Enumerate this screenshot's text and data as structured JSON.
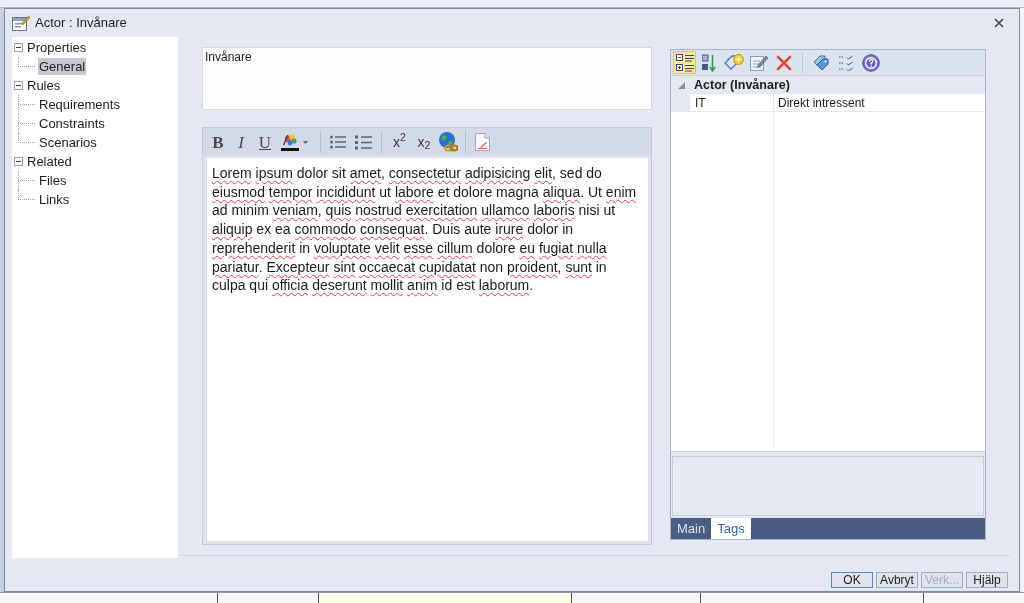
{
  "window": {
    "title": "Actor : Invånare"
  },
  "tree": [
    {
      "label": "Properties",
      "expanded": true,
      "selected": false,
      "children": [
        {
          "label": "General",
          "selected": true
        }
      ]
    },
    {
      "label": "Rules",
      "expanded": true,
      "selected": false,
      "children": [
        {
          "label": "Requirements",
          "selected": false
        },
        {
          "label": "Constraints",
          "selected": false
        },
        {
          "label": "Scenarios",
          "selected": false
        }
      ]
    },
    {
      "label": "Related",
      "expanded": true,
      "selected": false,
      "children": [
        {
          "label": "Files",
          "selected": false
        },
        {
          "label": "Links",
          "selected": false
        }
      ]
    }
  ],
  "name_field": {
    "value": "Invånare"
  },
  "editor": {
    "toolbar": [
      {
        "kind": "bold",
        "label": "B"
      },
      {
        "kind": "italic",
        "label": "I"
      },
      {
        "kind": "underline",
        "label": "U"
      },
      {
        "kind": "font-color"
      },
      {
        "kind": "separator"
      },
      {
        "kind": "bullets"
      },
      {
        "kind": "numbering"
      },
      {
        "kind": "separator"
      },
      {
        "kind": "superscript",
        "label": "x$^{2}$"
      },
      {
        "kind": "subscript",
        "label": "x$_{2}$"
      },
      {
        "kind": "hyperlink"
      },
      {
        "kind": "separator"
      },
      {
        "kind": "document"
      }
    ],
    "runs": [
      {
        "text": "Lorem ipsum",
        "misspelled": true
      },
      {
        "text": " dolor sit ",
        "misspelled": false
      },
      {
        "text": "amet",
        "misspelled": true
      },
      {
        "text": ", ",
        "misspelled": false
      },
      {
        "text": "consectetur adipisicing elit",
        "misspelled": true
      },
      {
        "text": ", sed do ",
        "misspelled": false
      },
      {
        "text": "eiusmod tempor incididunt",
        "misspelled": true
      },
      {
        "text": " ut ",
        "misspelled": false
      },
      {
        "text": "labore",
        "misspelled": true
      },
      {
        "text": " et dolore magna ",
        "misspelled": false
      },
      {
        "text": "aliqua",
        "misspelled": true
      },
      {
        "text": ". Ut ",
        "misspelled": false
      },
      {
        "text": "enim",
        "misspelled": true
      },
      {
        "text": " ad minim ",
        "misspelled": false
      },
      {
        "text": "veniam",
        "misspelled": true
      },
      {
        "text": ", ",
        "misspelled": false
      },
      {
        "text": "quis nostrud exercitation ullamco laboris",
        "misspelled": true
      },
      {
        "text": " nisi ut ",
        "misspelled": false
      },
      {
        "text": "aliquip",
        "misspelled": true
      },
      {
        "text": " ex ea ",
        "misspelled": false
      },
      {
        "text": "commodo consequat",
        "misspelled": true
      },
      {
        "text": ". Duis aute ",
        "misspelled": false
      },
      {
        "text": "irure",
        "misspelled": true
      },
      {
        "text": " dolor in ",
        "misspelled": false
      },
      {
        "text": "reprehenderit",
        "misspelled": true
      },
      {
        "text": " in ",
        "misspelled": false
      },
      {
        "text": "voluptate velit esse cillum",
        "misspelled": true
      },
      {
        "text": " dolore ",
        "misspelled": false
      },
      {
        "text": "eu fugiat nulla pariatur",
        "misspelled": true
      },
      {
        "text": ". ",
        "misspelled": false
      },
      {
        "text": "Excepteur sint occaecat cupidatat",
        "misspelled": true
      },
      {
        "text": " non ",
        "misspelled": false
      },
      {
        "text": "proident",
        "misspelled": true
      },
      {
        "text": ", ",
        "misspelled": false
      },
      {
        "text": "sunt",
        "misspelled": true
      },
      {
        "text": " in culpa qui ",
        "misspelled": false
      },
      {
        "text": "officia deserunt mollit anim",
        "misspelled": true
      },
      {
        "text": " id est ",
        "misspelled": false
      },
      {
        "text": "laborum",
        "misspelled": true
      },
      {
        "text": ".",
        "misspelled": false
      }
    ]
  },
  "properties": {
    "toolbar": [
      {
        "kind": "categorized",
        "selected": true
      },
      {
        "kind": "sort",
        "selected": false
      },
      {
        "kind": "new-tag"
      },
      {
        "kind": "edit"
      },
      {
        "kind": "delete"
      },
      {
        "kind": "separator"
      },
      {
        "kind": "tags"
      },
      {
        "kind": "checklist"
      },
      {
        "kind": "help"
      }
    ],
    "groups": [
      {
        "title": "Actor (Invånare)",
        "expanded": true,
        "rows": [
          {
            "name": "IT",
            "value": "Direkt intressent"
          }
        ]
      }
    ],
    "tabs": [
      {
        "label": "Main",
        "selected": false
      },
      {
        "label": "Tags",
        "selected": true
      }
    ]
  },
  "buttons": [
    {
      "label": "OK",
      "default": true,
      "disabled": false
    },
    {
      "label": "Avbryt",
      "default": false,
      "disabled": false
    },
    {
      "label": "Verk...",
      "default": false,
      "disabled": true
    },
    {
      "label": "Hjälp",
      "default": false,
      "disabled": false
    }
  ]
}
